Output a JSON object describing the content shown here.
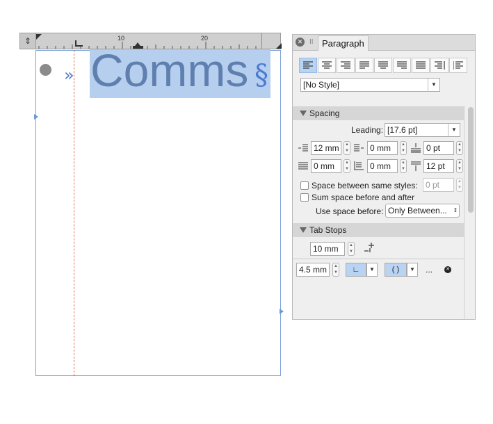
{
  "canvas": {
    "ruler": {
      "handle_icon": "ruler-move-icon",
      "labels": [
        "10",
        "20"
      ]
    },
    "text_frame": {
      "bullet_icon": "bullet-dot-icon",
      "tab_marker": "»",
      "text": "Comms",
      "paragraph_mark": "§"
    }
  },
  "panel": {
    "close_icon": "close-icon",
    "grip": "II",
    "title": "Paragraph",
    "alignment_buttons": [
      {
        "name": "align-left",
        "active": true
      },
      {
        "name": "align-center",
        "active": false
      },
      {
        "name": "align-right",
        "active": false
      },
      {
        "name": "justify-left",
        "active": false
      },
      {
        "name": "justify-center",
        "active": false
      },
      {
        "name": "justify-right",
        "active": false
      },
      {
        "name": "justify-all",
        "active": false
      },
      {
        "name": "align-towards-spine",
        "active": false
      },
      {
        "name": "align-away-from-spine",
        "active": false
      }
    ],
    "style_dropdown": "[No Style]",
    "spacing": {
      "header": "Spacing",
      "leading_label": "Leading:",
      "leading_value": "[17.6 pt]",
      "left_indent": "12 mm",
      "first_line_indent": "0 mm",
      "space_before": "0 pt",
      "right_indent": "0 mm",
      "last_line_indent": "0 mm",
      "space_after": "12 pt",
      "space_between_same_label": "Space between same styles:",
      "space_between_same_value": "0 pt",
      "sum_space_label": "Sum space before and after",
      "use_space_before_label": "Use space before:",
      "use_space_before_value": "Only Between..."
    },
    "tab_stops": {
      "header": "Tab Stops",
      "default_spacing": "10 mm",
      "add_icon": "add-tab-stop-icon",
      "stop_position": "4.5 mm",
      "stop_type": "∟",
      "stop_alignment": "( )",
      "more": "...",
      "delete_icon": "delete-tab-stop-icon"
    }
  },
  "colors": {
    "accent": "#b9d3f3",
    "frame_blue": "#7aa0d8",
    "margin_red": "#e0705a",
    "text_selected": "#5f7fae"
  }
}
